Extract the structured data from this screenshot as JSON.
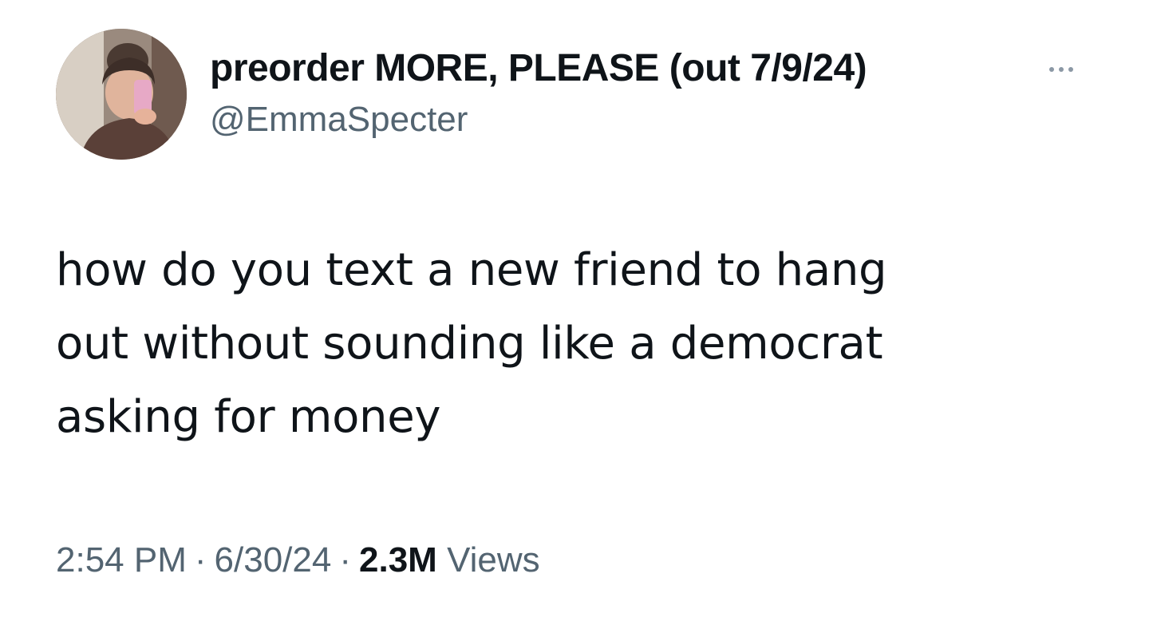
{
  "tweet": {
    "display_name": "preorder MORE, PLEASE (out 7/9/24)",
    "handle": "@EmmaSpecter",
    "more_icon": "more-horizontal-icon",
    "text_lines": [
      "how do you text a new friend to hang",
      "out without sounding like a democrat",
      "asking for money"
    ],
    "time": "2:54 PM",
    "separator": "·",
    "date": "6/30/24",
    "views_count": "2.3M",
    "views_label": "Views"
  },
  "colors": {
    "text_primary": "#0f1419",
    "text_secondary": "#536471",
    "background": "#ffffff"
  }
}
